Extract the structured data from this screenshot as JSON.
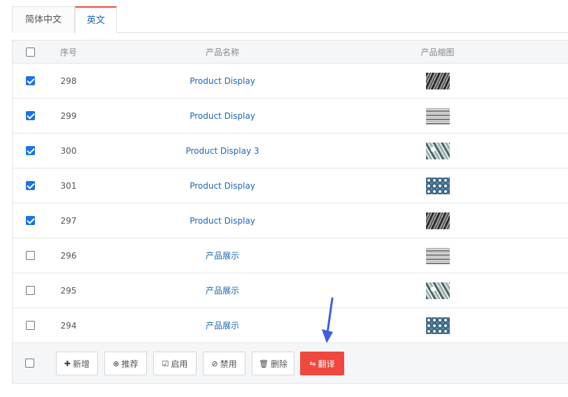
{
  "tabs": [
    {
      "label": "简体中文",
      "active": false
    },
    {
      "label": "英文",
      "active": true
    }
  ],
  "table": {
    "headers": {
      "id": "序号",
      "name": "产品名称",
      "thumb": "产品缩图"
    },
    "rows": [
      {
        "checked": true,
        "id": "298",
        "name": "Product Display",
        "thumb": "thumb-a"
      },
      {
        "checked": true,
        "id": "299",
        "name": "Product Display",
        "thumb": "thumb-b"
      },
      {
        "checked": true,
        "id": "300",
        "name": "Product Display 3",
        "thumb": "thumb-c"
      },
      {
        "checked": true,
        "id": "301",
        "name": "Product Display",
        "thumb": "thumb-d"
      },
      {
        "checked": true,
        "id": "297",
        "name": "Product Display",
        "thumb": "thumb-a"
      },
      {
        "checked": false,
        "id": "296",
        "name": "产品展示",
        "thumb": "thumb-b"
      },
      {
        "checked": false,
        "id": "295",
        "name": "产品展示",
        "thumb": "thumb-c"
      },
      {
        "checked": false,
        "id": "294",
        "name": "产品展示",
        "thumb": "thumb-d"
      }
    ]
  },
  "footer": {
    "add": "新增",
    "recommend": "推荐",
    "enable": "启用",
    "disable": "禁用",
    "delete": "删除",
    "translate": "翻译"
  },
  "colors": {
    "accent_red": "#f0483e",
    "link_blue": "#1e66b5",
    "checkbox_blue": "#1a73e8",
    "arrow_blue": "#3d5ee0"
  }
}
